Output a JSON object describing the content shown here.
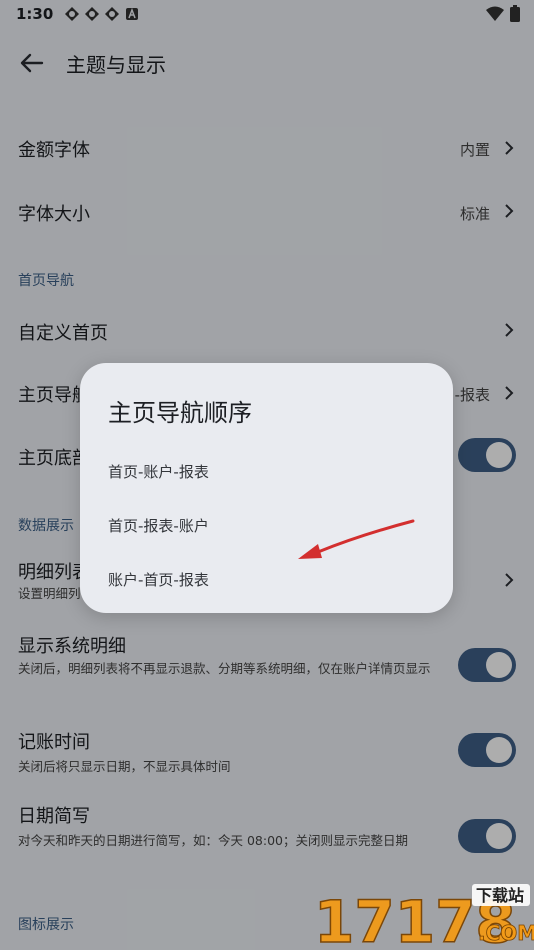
{
  "status": {
    "time": "1:30"
  },
  "appbar": {
    "title": "主题与显示"
  },
  "settings": {
    "amount_font": {
      "label": "金额字体",
      "value": "内置"
    },
    "font_size": {
      "label": "字体大小",
      "value": "标准"
    },
    "section_home_nav": "首页导航",
    "custom_home": {
      "label": "自定义首页"
    },
    "main_nav": {
      "label": "主页导航顺序",
      "label_visible": "主页导航",
      "value": "首页-账户-报表",
      "value_visible": "-报表"
    },
    "main_bottom": {
      "label_visible": "主页底部"
    },
    "section_data": "数据展示",
    "detail_list": {
      "label_visible": "明细列表",
      "desc_visible": "设置明细列"
    },
    "system_detail": {
      "label": "显示系统明细",
      "desc": "关闭后，明细列表将不再显示退款、分期等系统明细，仅在账户详情页显示"
    },
    "record_time": {
      "label": "记账时间",
      "desc": "关闭后将只显示日期，不显示具体时间"
    },
    "date_short": {
      "label": "日期简写",
      "desc": "对今天和昨天的日期进行简写，如：今天 08:00；关闭则显示完整日期"
    },
    "section_icon": "图标展示"
  },
  "dialog": {
    "title": "主页导航顺序",
    "options": [
      "首页-账户-报表",
      "首页-报表-账户",
      "账户-首页-报表"
    ]
  },
  "colors": {
    "accent": "#3f5f86",
    "annotation_arrow": "#d32f2f",
    "watermark_orange": "#f29a17"
  },
  "watermark": {
    "text": "17178",
    "sub": "下载站",
    "domain": ".COM"
  }
}
